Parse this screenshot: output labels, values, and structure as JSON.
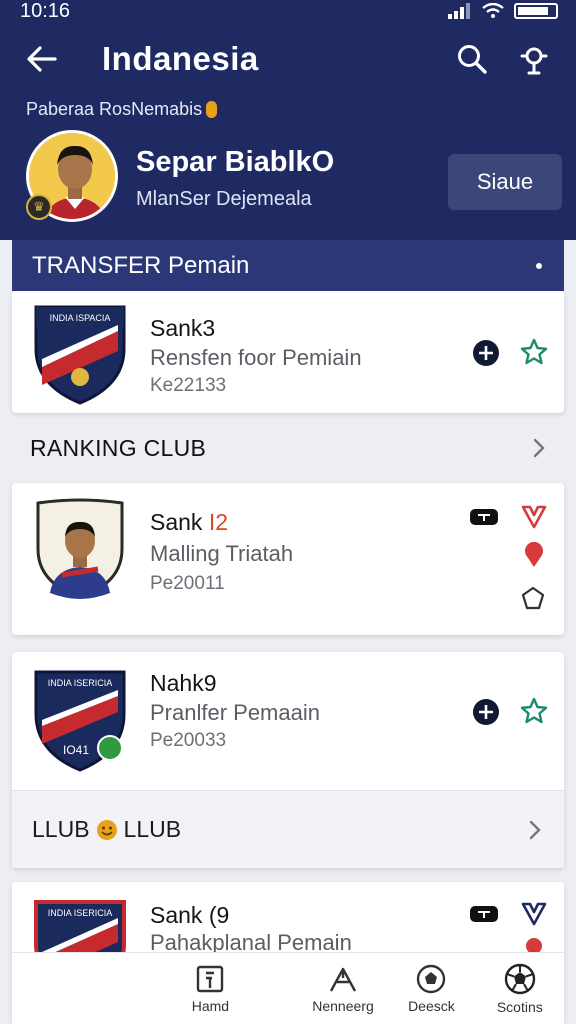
{
  "status_bar": {
    "time": "10:16"
  },
  "app_bar": {
    "title": "Indanesia"
  },
  "profile": {
    "caption": "Paberaa RosNemabis",
    "name": "Separ BiablkO",
    "subtitle": "MlanSer Dejemeala",
    "button_label": "Siaue"
  },
  "transfer_section": {
    "title": "TRANSFER Pemain"
  },
  "cards": [
    {
      "name_prefix": "Sank3",
      "name_highlight": "",
      "subtitle": "Rensfen foor Pemiain",
      "meta": "Ke22133"
    },
    {
      "name_prefix": "Sank ",
      "name_highlight": "I2",
      "subtitle": "Malling Triatah",
      "meta": "Pe20011"
    },
    {
      "name_prefix": "Nahk9",
      "name_highlight": "",
      "subtitle": "Pranlfer Pemaain",
      "meta": "Pe20033"
    },
    {
      "name_prefix": "Sank (9",
      "name_highlight": "",
      "subtitle": "Pahakplanal Pemain",
      "meta": ""
    }
  ],
  "sections": {
    "ranking": "RANKING CLUB",
    "club": "LLUB",
    "club_suffix": "LLUB"
  },
  "crest_text": {
    "crest1": "INDIA ISPACIA",
    "crest3": "INDIA ISERICIA",
    "crest4": "INDIA ISERICIA",
    "crest3_label": "IO41"
  },
  "bottom_nav": [
    {
      "label": "Hamd",
      "icon": "home-icon"
    },
    {
      "label": "Nenneerg",
      "icon": "ranking-icon"
    },
    {
      "label": "Deesck",
      "icon": "ball-icon"
    },
    {
      "label": "Scotins",
      "icon": "football-icon"
    }
  ],
  "colors": {
    "primary": "#1f2a63",
    "header_bar": "#2c3777",
    "accent_orange": "#d44b1d",
    "accent_teal": "#1b8a6b",
    "accent_red": "#d63a3a"
  }
}
